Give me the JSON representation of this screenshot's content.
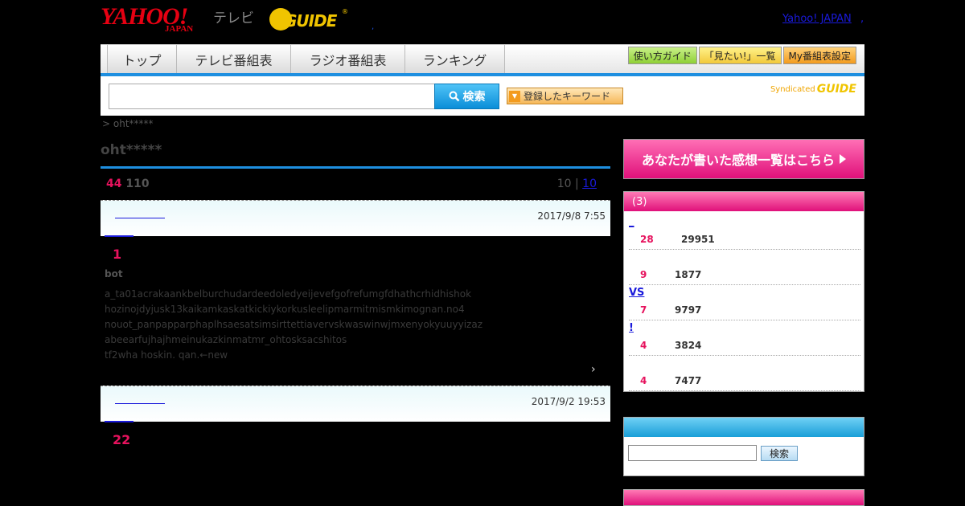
{
  "header": {
    "logo_yahoo": "YAHOO!",
    "logo_japan": "JAPAN",
    "logo_tv": "テレビ",
    "logo_gguide": "GUIDE",
    "logo_registered": "®",
    "yahoo_link": "Yahoo! JAPAN",
    "dot_left": ",",
    "dot_right": ","
  },
  "nav": {
    "tabs": [
      "トップ",
      "テレビ番組表",
      "ラジオ番組表",
      "ランキング"
    ],
    "right_buttons": [
      "使い方ガイド",
      "「見たい!」一覧",
      "My番組表設定"
    ]
  },
  "search": {
    "button_label": "検索",
    "keyword_button": "登録したキーワード",
    "syndicated_text": "Syndicated",
    "syndicated_logo": "GUIDE"
  },
  "breadcrumb": "> oht*****",
  "page_title": "oht*****",
  "counts": {
    "a": "44",
    "b": "110"
  },
  "paging": {
    "prefix": "10 |",
    "link": "10"
  },
  "entries": [
    {
      "date": "2017/9/8 7:55",
      "number": "1",
      "bot": "bot",
      "lines": [
        "a_ta01acrakaankbelburchudardeedoledyeijevefgofrefumgfdhathcrhidhishok",
        "hozinojdyjusk13kaikamkaskatkickiykorkusleelipmarmitmismkimognan.no4",
        "nouot_panpapparphaplhsaesatsimsirttettiavervskwaswinwjmxenyokyuuyyizaz",
        "abeearfujhajhmeinukazkinmatmr_ohtosksacshitos",
        "tf2wha hoskin. qan.←new"
      ],
      "more": "›"
    },
    {
      "date": "2017/9/2 19:53",
      "number": "22"
    }
  ],
  "right": {
    "banner": "あなたが書いた感想一覧はこちら",
    "ranking_header": "(3)",
    "ranking": [
      {
        "title": "_",
        "a": "28",
        "b": "29951"
      },
      {
        "title": "",
        "a": "9",
        "b": "1877"
      },
      {
        "title": "VS",
        "a": "7",
        "b": "9797"
      },
      {
        "title": "!",
        "a": "4",
        "b": "3824"
      },
      {
        "title": "",
        "a": "4",
        "b": "7477"
      }
    ],
    "search_button": "検索"
  },
  "colors": {
    "accent_blue": "#1e8fe0",
    "accent_pink": "#e6125d",
    "link": "#1a1adb"
  }
}
